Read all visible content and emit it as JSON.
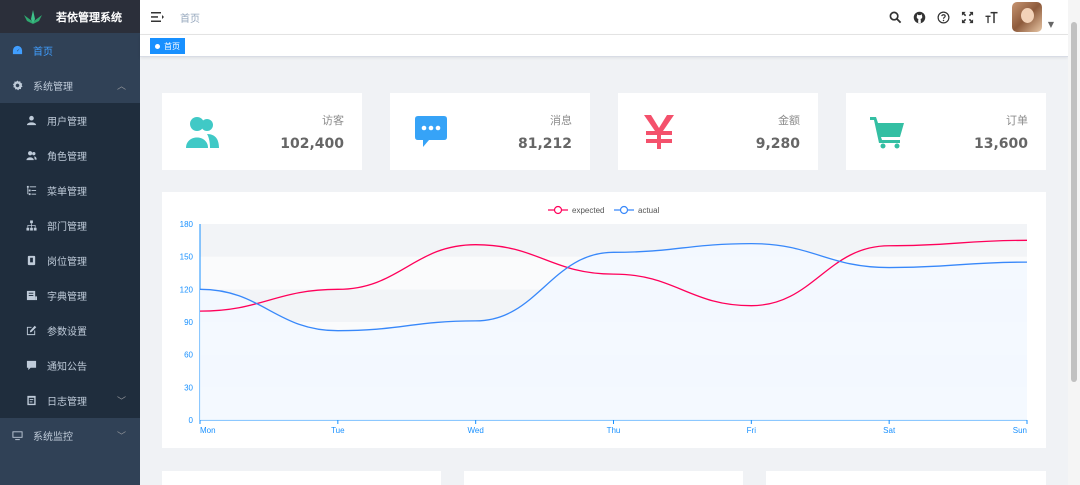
{
  "app": {
    "title": "若依管理系统"
  },
  "sidebar": {
    "items": [
      {
        "label": "首页",
        "icon": "dashboard-icon",
        "active": true
      },
      {
        "label": "系统管理",
        "icon": "gear-icon",
        "expanded": true,
        "children": [
          {
            "label": "用户管理",
            "icon": "user-icon"
          },
          {
            "label": "角色管理",
            "icon": "peoples-icon"
          },
          {
            "label": "菜单管理",
            "icon": "tree-table-icon"
          },
          {
            "label": "部门管理",
            "icon": "tree-icon"
          },
          {
            "label": "岗位管理",
            "icon": "post-icon"
          },
          {
            "label": "字典管理",
            "icon": "dict-icon"
          },
          {
            "label": "参数设置",
            "icon": "edit-icon"
          },
          {
            "label": "通知公告",
            "icon": "message-icon"
          },
          {
            "label": "日志管理",
            "icon": "log-icon"
          }
        ]
      },
      {
        "label": "系统监控",
        "icon": "monitor-icon"
      }
    ]
  },
  "navbar": {
    "breadcrumb": "首页",
    "icons": [
      "search-icon",
      "github-icon",
      "help-icon",
      "fullscreen-icon",
      "font-size-icon"
    ]
  },
  "tags": [
    {
      "label": "首页",
      "active": true
    }
  ],
  "cards": [
    {
      "label": "访客",
      "value": "102,400",
      "icon": "peoples-icon",
      "color": "#40c9c6"
    },
    {
      "label": "消息",
      "value": "81,212",
      "icon": "message-icon",
      "color": "#36a3f7"
    },
    {
      "label": "金额",
      "value": "9,280",
      "icon": "money-icon",
      "color": "#f4516c"
    },
    {
      "label": "订单",
      "value": "13,600",
      "icon": "shopping-icon",
      "color": "#34bfa3"
    }
  ],
  "colors": {
    "expected": "#FF005A",
    "actual": "#3888fa",
    "axis": "#1890ff"
  },
  "chart_data": {
    "type": "line",
    "categories": [
      "Mon",
      "Tue",
      "Wed",
      "Thu",
      "Fri",
      "Sat",
      "Sun"
    ],
    "series": [
      {
        "name": "expected",
        "values": [
          100,
          120,
          161,
          134,
          105,
          160,
          165
        ]
      },
      {
        "name": "actual",
        "values": [
          120,
          82,
          91,
          154,
          162,
          140,
          145
        ]
      }
    ],
    "yticks": [
      "0",
      "30",
      "60",
      "90",
      "120",
      "150",
      "180"
    ],
    "ylim": [
      0,
      180
    ],
    "legend": "top-center"
  }
}
